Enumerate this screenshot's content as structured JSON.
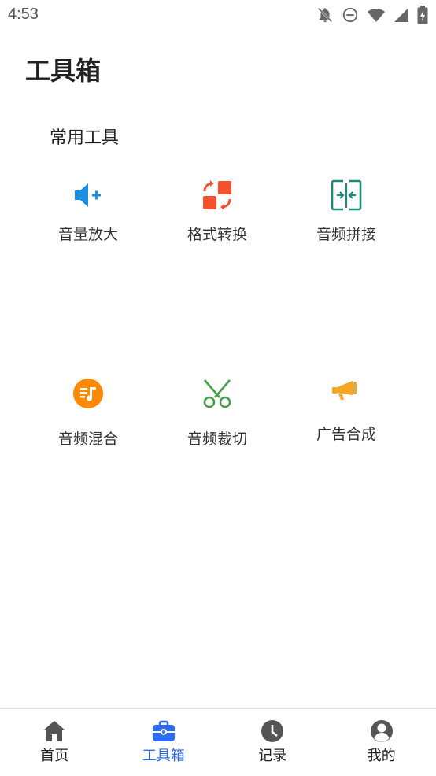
{
  "status_bar": {
    "time": "4:53",
    "icons": [
      "bell-off-icon",
      "do-not-disturb-icon",
      "wifi-icon",
      "signal-icon",
      "battery-icon"
    ]
  },
  "page": {
    "title": "工具箱"
  },
  "section": {
    "title": "常用工具"
  },
  "tools": [
    {
      "label": "音量放大",
      "icon": "volume-plus-icon",
      "color": "#1a8fe0"
    },
    {
      "label": "格式转换",
      "icon": "format-convert-icon",
      "color": "#f2532e"
    },
    {
      "label": "音频拼接",
      "icon": "audio-merge-icon",
      "color": "#1b8a7a"
    },
    {
      "label": "音频混合",
      "icon": "music-mix-icon",
      "color": "#ff8a00"
    },
    {
      "label": "音频裁切",
      "icon": "scissors-icon",
      "color": "#43a047"
    },
    {
      "label": "广告合成",
      "icon": "megaphone-icon",
      "color": "#f5a623"
    }
  ],
  "bottom_nav": [
    {
      "label": "首页",
      "icon": "home-icon",
      "active": false
    },
    {
      "label": "工具箱",
      "icon": "toolbox-icon",
      "active": true
    },
    {
      "label": "记录",
      "icon": "clock-icon",
      "active": false
    },
    {
      "label": "我的",
      "icon": "user-icon",
      "active": false
    }
  ],
  "colors": {
    "accent": "#2f6cf4",
    "nav_icon": "#555555"
  }
}
